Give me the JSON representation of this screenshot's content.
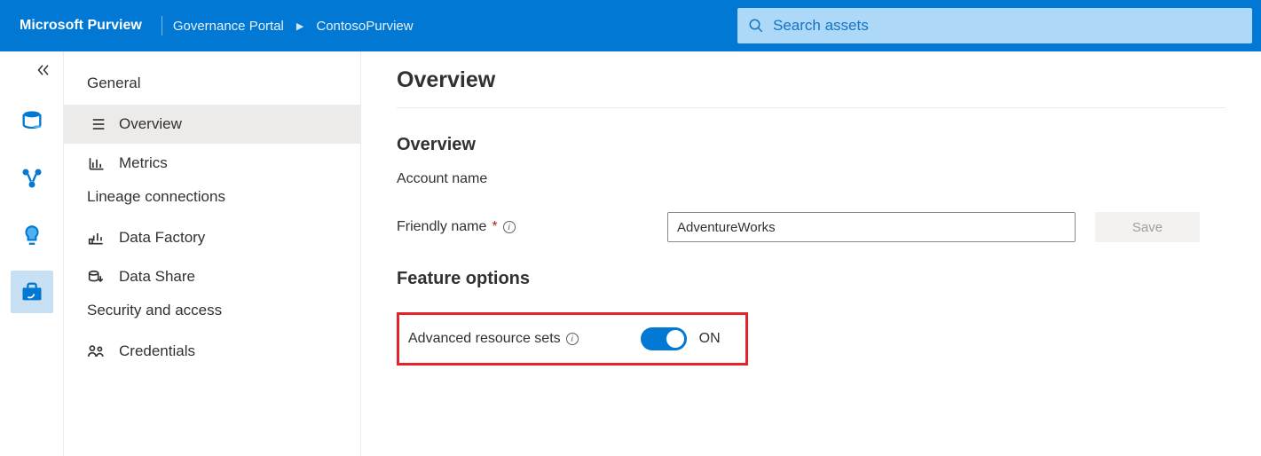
{
  "brand": "Microsoft Purview",
  "breadcrumbs": {
    "portal": "Governance Portal",
    "account": "ContosoPurview"
  },
  "search": {
    "placeholder": "Search assets"
  },
  "sidebar": {
    "group_general": "General",
    "items": [
      {
        "label": "Overview"
      },
      {
        "label": "Metrics"
      }
    ],
    "group_lineage": "Lineage connections",
    "lineage_items": [
      {
        "label": "Data Factory"
      },
      {
        "label": "Data Share"
      }
    ],
    "group_security": "Security and access",
    "security_items": [
      {
        "label": "Credentials"
      }
    ]
  },
  "main": {
    "page_title": "Overview",
    "section_overview": "Overview",
    "account_name_label": "Account name",
    "friendly_name_label": "Friendly name",
    "friendly_name_value": "AdventureWorks",
    "save_label": "Save",
    "section_feature": "Feature options",
    "adv_resource_sets_label": "Advanced resource sets",
    "toggle_state": "ON"
  }
}
